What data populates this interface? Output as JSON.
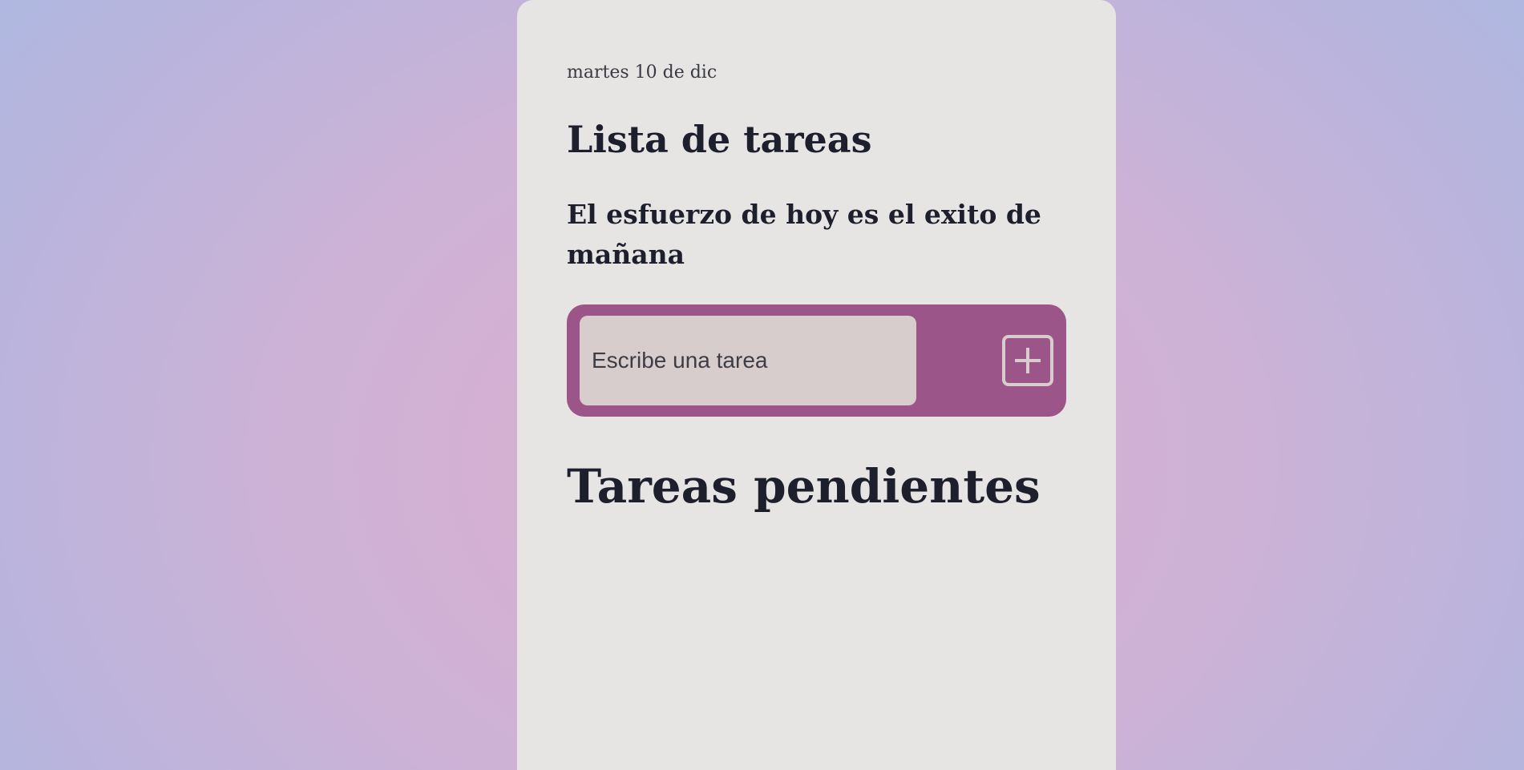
{
  "header": {
    "date": "martes 10 de dic",
    "title": "Lista de tareas",
    "quote": "El esfuerzo de hoy es el exito de mañana"
  },
  "task_form": {
    "input_value": "",
    "placeholder": "Escribe una tarea",
    "add_icon": "plus-square-icon"
  },
  "pending": {
    "title": "Tareas pendientes",
    "items": []
  },
  "colors": {
    "card": "#e7e5e3",
    "form_accent": "#9c5589",
    "input_bg": "#d8cdcd",
    "text_dark": "#1d1f2d"
  }
}
